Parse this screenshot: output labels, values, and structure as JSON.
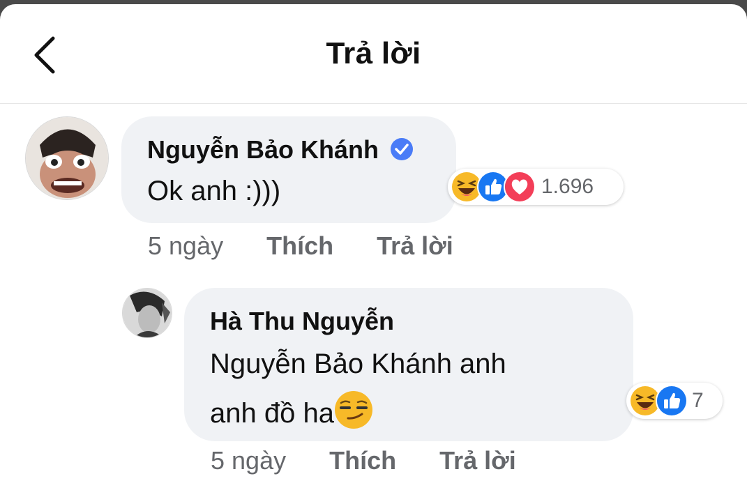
{
  "header": {
    "title": "Trả lời"
  },
  "comment": {
    "author": "Nguyễn Bảo Khánh",
    "text": "Ok anh :)))",
    "reaction_count": "1.696",
    "time": "5 ngày",
    "like_label": "Thích",
    "reply_label": "Trả lời"
  },
  "reply": {
    "author": "Hà Thu Nguyễn",
    "text_line1": "Nguyễn Bảo Khánh anh",
    "text_line2": "anh đồ ha",
    "reaction_count": "7",
    "time": "5 ngày",
    "like_label": "Thích",
    "reply_label": "Trả lời"
  },
  "colors": {
    "bubble": "#f0f2f5",
    "muted_text": "#65676b",
    "like_blue": "#1877f2",
    "love_red": "#f33e58",
    "haha_yellow": "#f7b928",
    "verified_blue": "#4a7cf7"
  },
  "icons": [
    "back-chevron-icon",
    "verified-badge-icon",
    "haha-reaction-icon",
    "like-reaction-icon",
    "love-reaction-icon",
    "smirk-emoji-icon"
  ]
}
